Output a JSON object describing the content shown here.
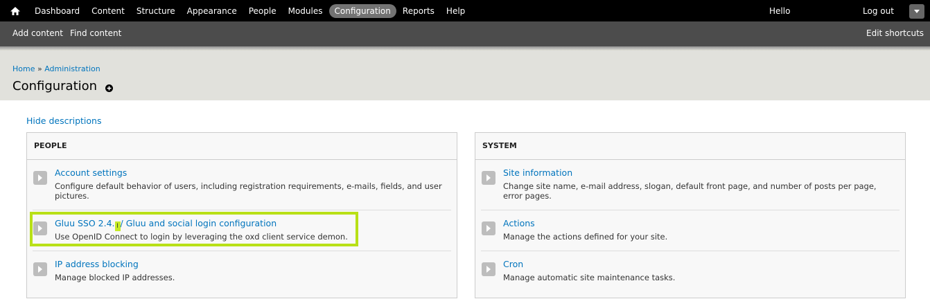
{
  "toolbar": {
    "home_icon": "home-icon",
    "menu": [
      {
        "label": "Dashboard",
        "active": false
      },
      {
        "label": "Content",
        "active": false
      },
      {
        "label": "Structure",
        "active": false
      },
      {
        "label": "Appearance",
        "active": false
      },
      {
        "label": "People",
        "active": false
      },
      {
        "label": "Modules",
        "active": false
      },
      {
        "label": "Configuration",
        "active": true
      },
      {
        "label": "Reports",
        "active": false
      },
      {
        "label": "Help",
        "active": false
      }
    ],
    "hello": "Hello",
    "logout": "Log out",
    "toggle_icon": "chevron-down-icon"
  },
  "shortcuts": {
    "add_content": "Add content",
    "find_content": "Find content",
    "edit_shortcuts": "Edit shortcuts"
  },
  "header": {
    "breadcrumb": {
      "home": "Home",
      "sep": " » ",
      "admin": "Administration"
    },
    "title": "Configuration",
    "add_icon": "plus-circle-icon"
  },
  "hide_descriptions": "Hide descriptions",
  "panels": {
    "people": {
      "title": "PEOPLE",
      "items": [
        {
          "title": "Account settings",
          "desc": "Configure default behavior of users, including registration requirements, e-mails, fields, and user pictures."
        },
        {
          "title_pre": "Gluu SSO 2.4.",
          "title_mark": "I",
          "title_post": "/ Gluu and social login configuration",
          "desc": "Use OpenID Connect to login by leveraging the oxd client service demon."
        },
        {
          "title": "IP address blocking",
          "desc": "Manage blocked IP addresses."
        }
      ]
    },
    "system": {
      "title": "SYSTEM",
      "items": [
        {
          "title": "Site information",
          "desc": "Change site name, e-mail address, slogan, default front page, and number of posts per page, error pages."
        },
        {
          "title": "Actions",
          "desc": "Manage the actions defined for your site."
        },
        {
          "title": "Cron",
          "desc": "Manage automatic site maintenance tasks."
        }
      ]
    }
  },
  "colors": {
    "link": "#0074bd",
    "toolbar_bg": "#000000",
    "shortcuts_bg": "#4c4c4c",
    "header_bg": "#e1e1dc",
    "highlight": "#b8e017"
  }
}
